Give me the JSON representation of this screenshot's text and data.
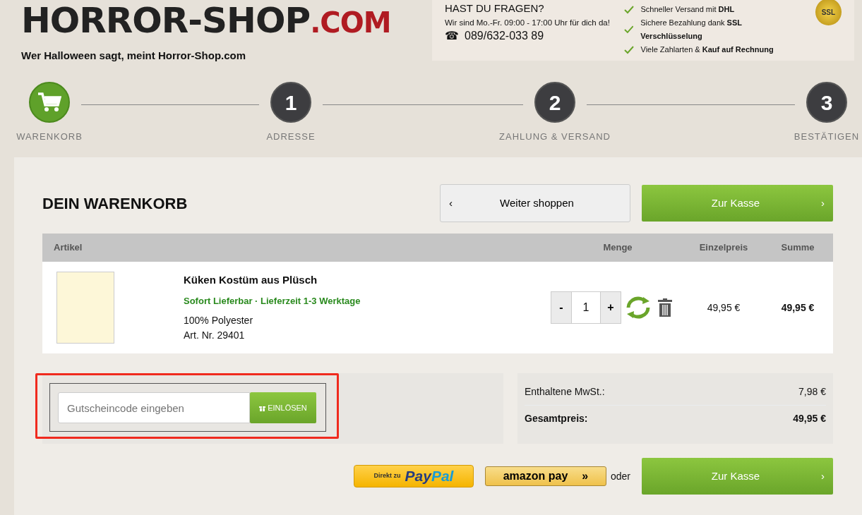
{
  "header": {
    "logo": {
      "name": "HORROR-SHOP",
      "tld": ".COM"
    },
    "tagline": "Wer Halloween sagt, meint Horror-Shop.com",
    "contact": {
      "title": "HAST DU FRAGEN?",
      "hours": "Wir sind Mo.-Fr. 09:00 - 17:00 Uhr für dich da!",
      "phone_icon": "☎",
      "phone": "089/632-033 89"
    },
    "benefits": [
      "Schneller Versand mit **DHL**",
      "Sichere Bezahlung dank **SSL Verschlüsselung**",
      "Viele Zahlarten & **Kauf auf Rechnung**"
    ],
    "badge": "SSL"
  },
  "steps": [
    {
      "kind": "icon",
      "label": "WARENKORB",
      "selected": true
    },
    {
      "kind": "number",
      "number": "1",
      "label": "ADRESSE",
      "selected": false
    },
    {
      "kind": "number",
      "number": "2",
      "label": "ZAHLUNG & VERSAND",
      "selected": false
    },
    {
      "kind": "number",
      "number": "3",
      "label": "BESTÄTIGEN",
      "selected": false
    }
  ],
  "cart": {
    "title": "DEIN WARENKORB",
    "continue_button": {
      "icon": "‹",
      "label": "Weiter shoppen"
    },
    "checkout_button": {
      "label": "Zur Kasse",
      "icon": "›"
    },
    "columns": [
      "Artikel",
      "Menge",
      "Einzelpreis",
      "Summe"
    ],
    "rows": [
      {
        "name": "Küken Kostüm aus Plüsch",
        "availability": "Sofort Lieferbar · Lieferzeit 1-3 Werktage",
        "material": "100% Polyester",
        "article_no": "Art. Nr. 29401",
        "minus": "-",
        "quantity": "1",
        "plus": "+",
        "unit_price": "49,95 €",
        "total": "49,95 €"
      }
    ]
  },
  "coupon": {
    "placeholder": "Gutscheincode eingeben",
    "button": "EINLÖSEN",
    "highlighted": true
  },
  "totals": [
    {
      "label": "Enthaltene MwSt.:",
      "value": "7,98 €",
      "bold": false
    },
    {
      "label": "Gesamtpreis:",
      "value": "49,95 €",
      "bold": true
    }
  ],
  "payment": {
    "paypal": {
      "prefix": "Direkt zu",
      "brand_a": "Pay",
      "brand_b": "Pal"
    },
    "amazon": {
      "brand": "amazon pay",
      "arrow": "»"
    },
    "or": "oder",
    "checkout_button": {
      "label": "Zur Kasse",
      "icon": "›"
    }
  }
}
